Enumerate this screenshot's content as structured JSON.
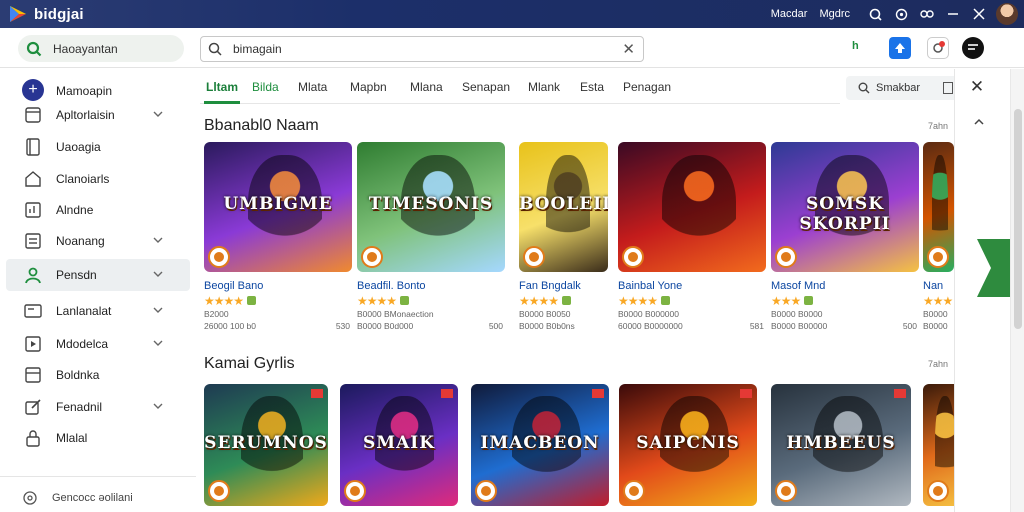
{
  "window": {
    "app_title": "bidgjai",
    "menu_left": "Macdar",
    "menu_right": "Mgdrc"
  },
  "sidebar_search": {
    "value": "Haoayantan"
  },
  "search": {
    "value": "bimagain"
  },
  "toolbar": {
    "green_label": "h"
  },
  "new_action": {
    "label": "Mamoapin"
  },
  "sidebar": {
    "items": [
      {
        "label": "Apltorlaisin"
      },
      {
        "label": "Uaoagia"
      },
      {
        "label": "Clanoiarls"
      },
      {
        "label": "Alndne"
      },
      {
        "label": "Noanang"
      },
      {
        "label": "Pensdn"
      },
      {
        "label": "Lanlanalat"
      },
      {
        "label": "Mdodelca"
      },
      {
        "label": "Boldnka"
      },
      {
        "label": "Fenadnil"
      },
      {
        "label": "Mlalal"
      }
    ],
    "footer": "Gencocc əolilani"
  },
  "tabs": [
    "Lltam",
    "Bilda",
    "Mlata",
    "Mapbn",
    "Mlana",
    "Senapan",
    "Mlank",
    "Esta",
    "Penagan"
  ],
  "filter": {
    "label": "Smakbar"
  },
  "section1": {
    "title": "Bbanabl0 Naam",
    "more": "7ahn",
    "cards": [
      {
        "art": "UMBIGME",
        "name": "Beogil Bano",
        "stars": "★★★★",
        "meta1": "B2000",
        "meta2": "26000  100 b0",
        "right": "530"
      },
      {
        "art": "TIMESONIS",
        "name": "Beadfil. Bonto",
        "stars": "★★★★",
        "meta1": "B0000  BMonaection",
        "meta2": "B0000  B0d000",
        "right": "500"
      },
      {
        "art": "BOOLEIL",
        "name": "Fan Bngdalk",
        "stars": "★★★★",
        "meta1": "B0000  B0050",
        "meta2": "B0000  B0b0ns",
        "right": ""
      },
      {
        "art": "",
        "name": "Bainbal Yone",
        "stars": "★★★★",
        "meta1": "B0000  B000000",
        "meta2": "60000  B0000000",
        "right": "581"
      },
      {
        "art": "SOMSK SKORPII",
        "name": "Masof Mnd",
        "stars": "★★★",
        "meta1": "B0000  B0000",
        "meta2": "B0000  B00000",
        "right": "500"
      },
      {
        "art": "",
        "name": "Nan",
        "stars": "★★★",
        "meta1": "B0000",
        "meta2": "B0000",
        "right": ""
      }
    ]
  },
  "section2": {
    "title": "Kamai Gyrlis",
    "more": "7ahn",
    "cards": [
      {
        "art": "SERUMNOS"
      },
      {
        "art": "SMAIK"
      },
      {
        "art": "IMACBEON"
      },
      {
        "art": "SAIPCNIS"
      },
      {
        "art": "HMBEEUS"
      },
      {
        "art": ""
      }
    ]
  },
  "colors": {
    "accent_green": "#1e8e3e",
    "titlebar": "#1c2f6a",
    "primary_blue": "#1a73e8",
    "star": "#f9a825"
  },
  "icons": {
    "titlebar": [
      "help-icon",
      "refresh-icon",
      "link-icon",
      "minimize-icon",
      "close-icon"
    ],
    "sidebar": [
      "app-icon",
      "page-icon",
      "home-icon",
      "chart-icon",
      "list-icon",
      "person-icon",
      "tv-icon",
      "media-icon",
      "doc-icon",
      "edit-icon",
      "lock-icon"
    ]
  }
}
